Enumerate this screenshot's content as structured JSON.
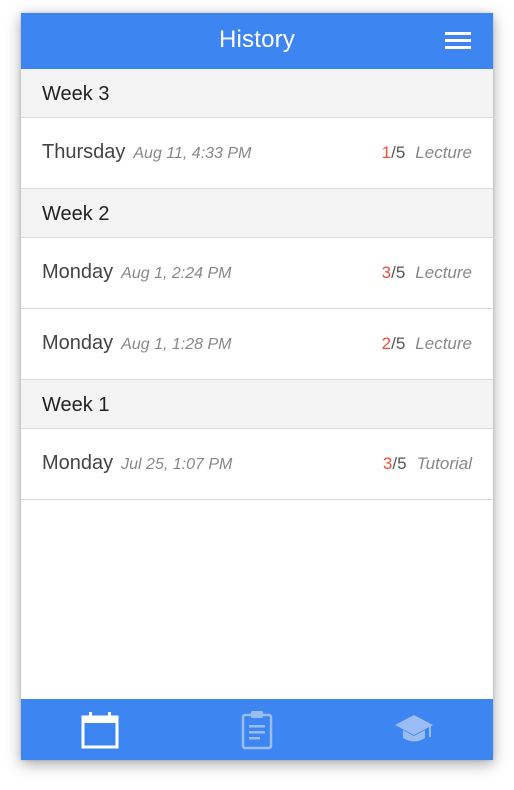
{
  "header": {
    "title": "History",
    "menu_icon": "hamburger-menu-icon"
  },
  "weeks": [
    {
      "label": "Week 3",
      "entries": [
        {
          "day": "Thursday",
          "date": "Aug 11, 4:33 PM",
          "score": "1",
          "total": "/5",
          "type": "Lecture"
        }
      ]
    },
    {
      "label": "Week 2",
      "entries": [
        {
          "day": "Monday",
          "date": "Aug 1, 2:24 PM",
          "score": "3",
          "total": "/5",
          "type": "Lecture"
        },
        {
          "day": "Monday",
          "date": "Aug 1, 1:28 PM",
          "score": "2",
          "total": "/5",
          "type": "Lecture"
        }
      ]
    },
    {
      "label": "Week 1",
      "entries": [
        {
          "day": "Monday",
          "date": "Jul 25, 1:07 PM",
          "score": "3",
          "total": "/5",
          "type": "Tutorial"
        }
      ]
    }
  ],
  "tabs": [
    {
      "icon": "calendar-icon",
      "active": true
    },
    {
      "icon": "clipboard-icon",
      "active": false
    },
    {
      "icon": "graduation-cap-icon",
      "active": false
    }
  ],
  "colors": {
    "primary": "#3d85f0",
    "score": "#e8523a",
    "header_bg": "#f3f3f3"
  }
}
